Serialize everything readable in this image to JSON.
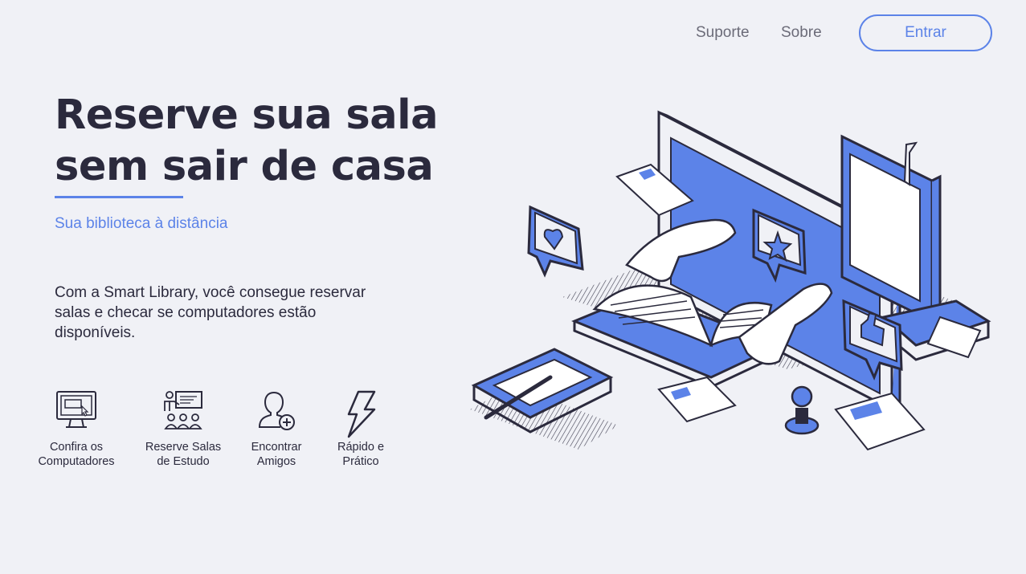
{
  "nav": {
    "links": [
      {
        "label": "Suporte"
      },
      {
        "label": "Sobre"
      }
    ],
    "login_label": "Entrar"
  },
  "hero": {
    "title": "Reserve sua sala sem sair de casa",
    "subtitle": "Sua biblioteca à distância",
    "description": "Com a Smart Library, você consegue reservar salas e checar se computadores estão disponíveis."
  },
  "features": [
    {
      "icon": "computer-icon",
      "label": "Confira os\nComputadores"
    },
    {
      "icon": "study-room-icon",
      "label": "Reserve Salas\nde Estudo"
    },
    {
      "icon": "add-user-icon",
      "label": "Encontrar\nAmigos"
    },
    {
      "icon": "lightning-icon",
      "label": "Rápido e\nPrático"
    }
  ],
  "colors": {
    "accent": "#5c83e8",
    "text_dark": "#2b2a3d",
    "background": "#f0f1f6"
  }
}
